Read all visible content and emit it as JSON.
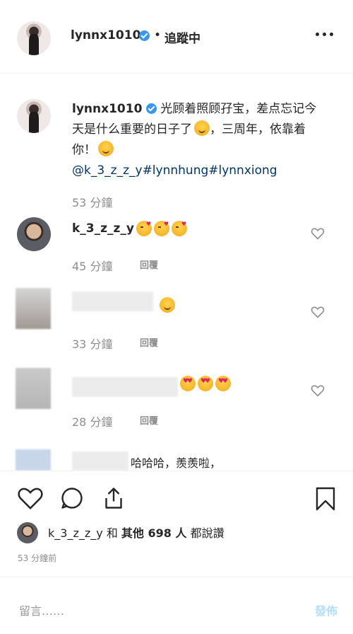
{
  "header": {
    "username": "lynnx1010",
    "separator": "•",
    "follow_status": "追蹤中"
  },
  "caption": {
    "username": "lynnx1010",
    "text_part1": "光顾着照顾孖宝，差点忘记今天是什么重要的日子了",
    "text_part2": "，三周年，依靠着你！",
    "tags": "@k_3_z_z_y#lynnhung#lynnxiong",
    "time": "53 分鐘"
  },
  "comments": [
    {
      "username": "k_3_z_z_y",
      "text": "",
      "time": "45 分鐘",
      "reply": "回覆"
    },
    {
      "username": "",
      "text": "",
      "time": "33 分鐘",
      "reply": "回覆"
    },
    {
      "username": "",
      "text": "",
      "time": "28 分鐘",
      "reply": "回覆"
    },
    {
      "username": "",
      "text": "哈哈哈，羨羨啦，",
      "time": "",
      "reply": ""
    }
  ],
  "likes": {
    "user": "k_3_z_z_y",
    "connector": "和",
    "others": "其他 698 人",
    "suffix": "都說讚"
  },
  "post_time": "53 分鐘前",
  "add_comment": {
    "placeholder": "留言……",
    "post_label": "發佈"
  },
  "icons": [
    "verified-icon",
    "more-icon",
    "heart-icon",
    "comment-icon",
    "share-icon",
    "bookmark-icon"
  ],
  "colors": {
    "verified": "#3897f0",
    "post_disabled": "#b2dffc",
    "tags": "#003569"
  }
}
